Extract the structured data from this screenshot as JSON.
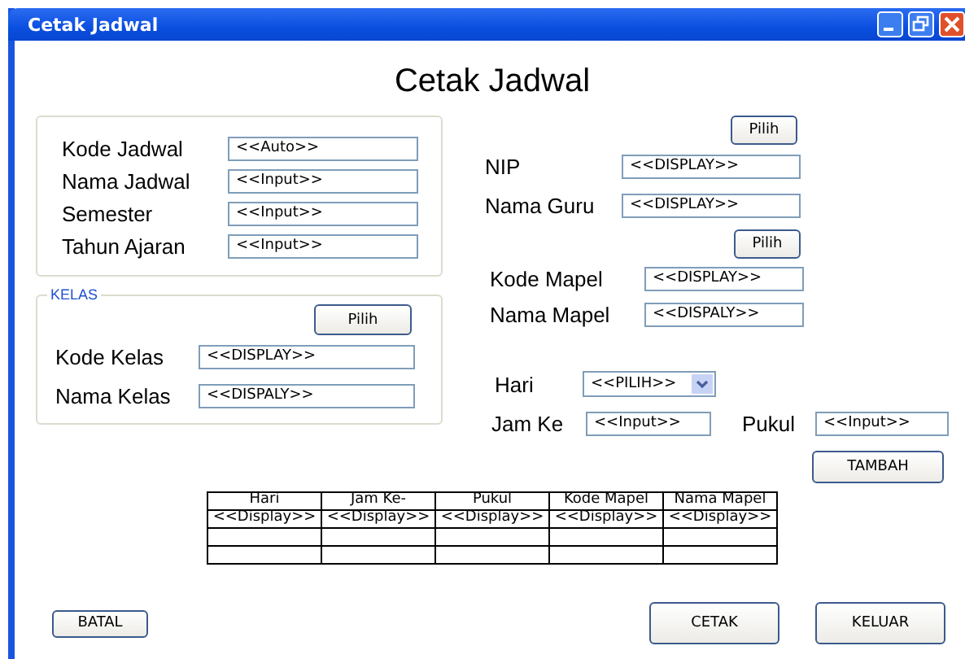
{
  "window": {
    "title": "Cetak Jadwal"
  },
  "heading": "Cetak Jadwal",
  "jadwal_panel": {
    "fields": [
      {
        "label": "Kode Jadwal",
        "value": "<<Auto>>"
      },
      {
        "label": "Nama Jadwal",
        "value": "<<Input>>"
      },
      {
        "label": "Semester",
        "value": "<<Input>>"
      },
      {
        "label": "Tahun Ajaran",
        "value": "<<Input>>"
      }
    ]
  },
  "kelas_panel": {
    "legend": "KELAS",
    "button": "Pilih",
    "fields": [
      {
        "label": "Kode Kelas",
        "value": "<<DISPLAY>>"
      },
      {
        "label": "Nama Kelas",
        "value": "<<DISPALY>>"
      }
    ]
  },
  "guru": {
    "button": "Pilih",
    "fields": [
      {
        "label": "NIP",
        "value": "<<DISPLAY>>"
      },
      {
        "label": "Nama Guru",
        "value": "<<DISPLAY>>"
      }
    ]
  },
  "mapel": {
    "button": "Pilih",
    "fields": [
      {
        "label": "Kode Mapel",
        "value": "<<DISPLAY>>"
      },
      {
        "label": "Nama Mapel",
        "value": "<<DISPALY>>"
      }
    ]
  },
  "hari": {
    "label": "Hari",
    "value": "<<PILIH>>"
  },
  "jam_ke": {
    "label": "Jam Ke",
    "value": "<<Input>>"
  },
  "pukul": {
    "label": "Pukul",
    "value": "<<Input>>"
  },
  "add_button": "TAMBAH",
  "table": {
    "columns": [
      "Hari",
      "Jam Ke-",
      "Pukul",
      "Kode Mapel",
      "Nama Mapel"
    ],
    "rows": [
      {
        "kind": "data",
        "cells": [
          "<<Display>>",
          "<<Display>>",
          "<<Display>>",
          "<<Display>>",
          "<<Display>>"
        ]
      },
      {
        "kind": "blank"
      },
      {
        "kind": "blank"
      }
    ]
  },
  "cancel_button": "BATAL",
  "buttons": [
    "CETAK",
    "KELUAR"
  ]
}
